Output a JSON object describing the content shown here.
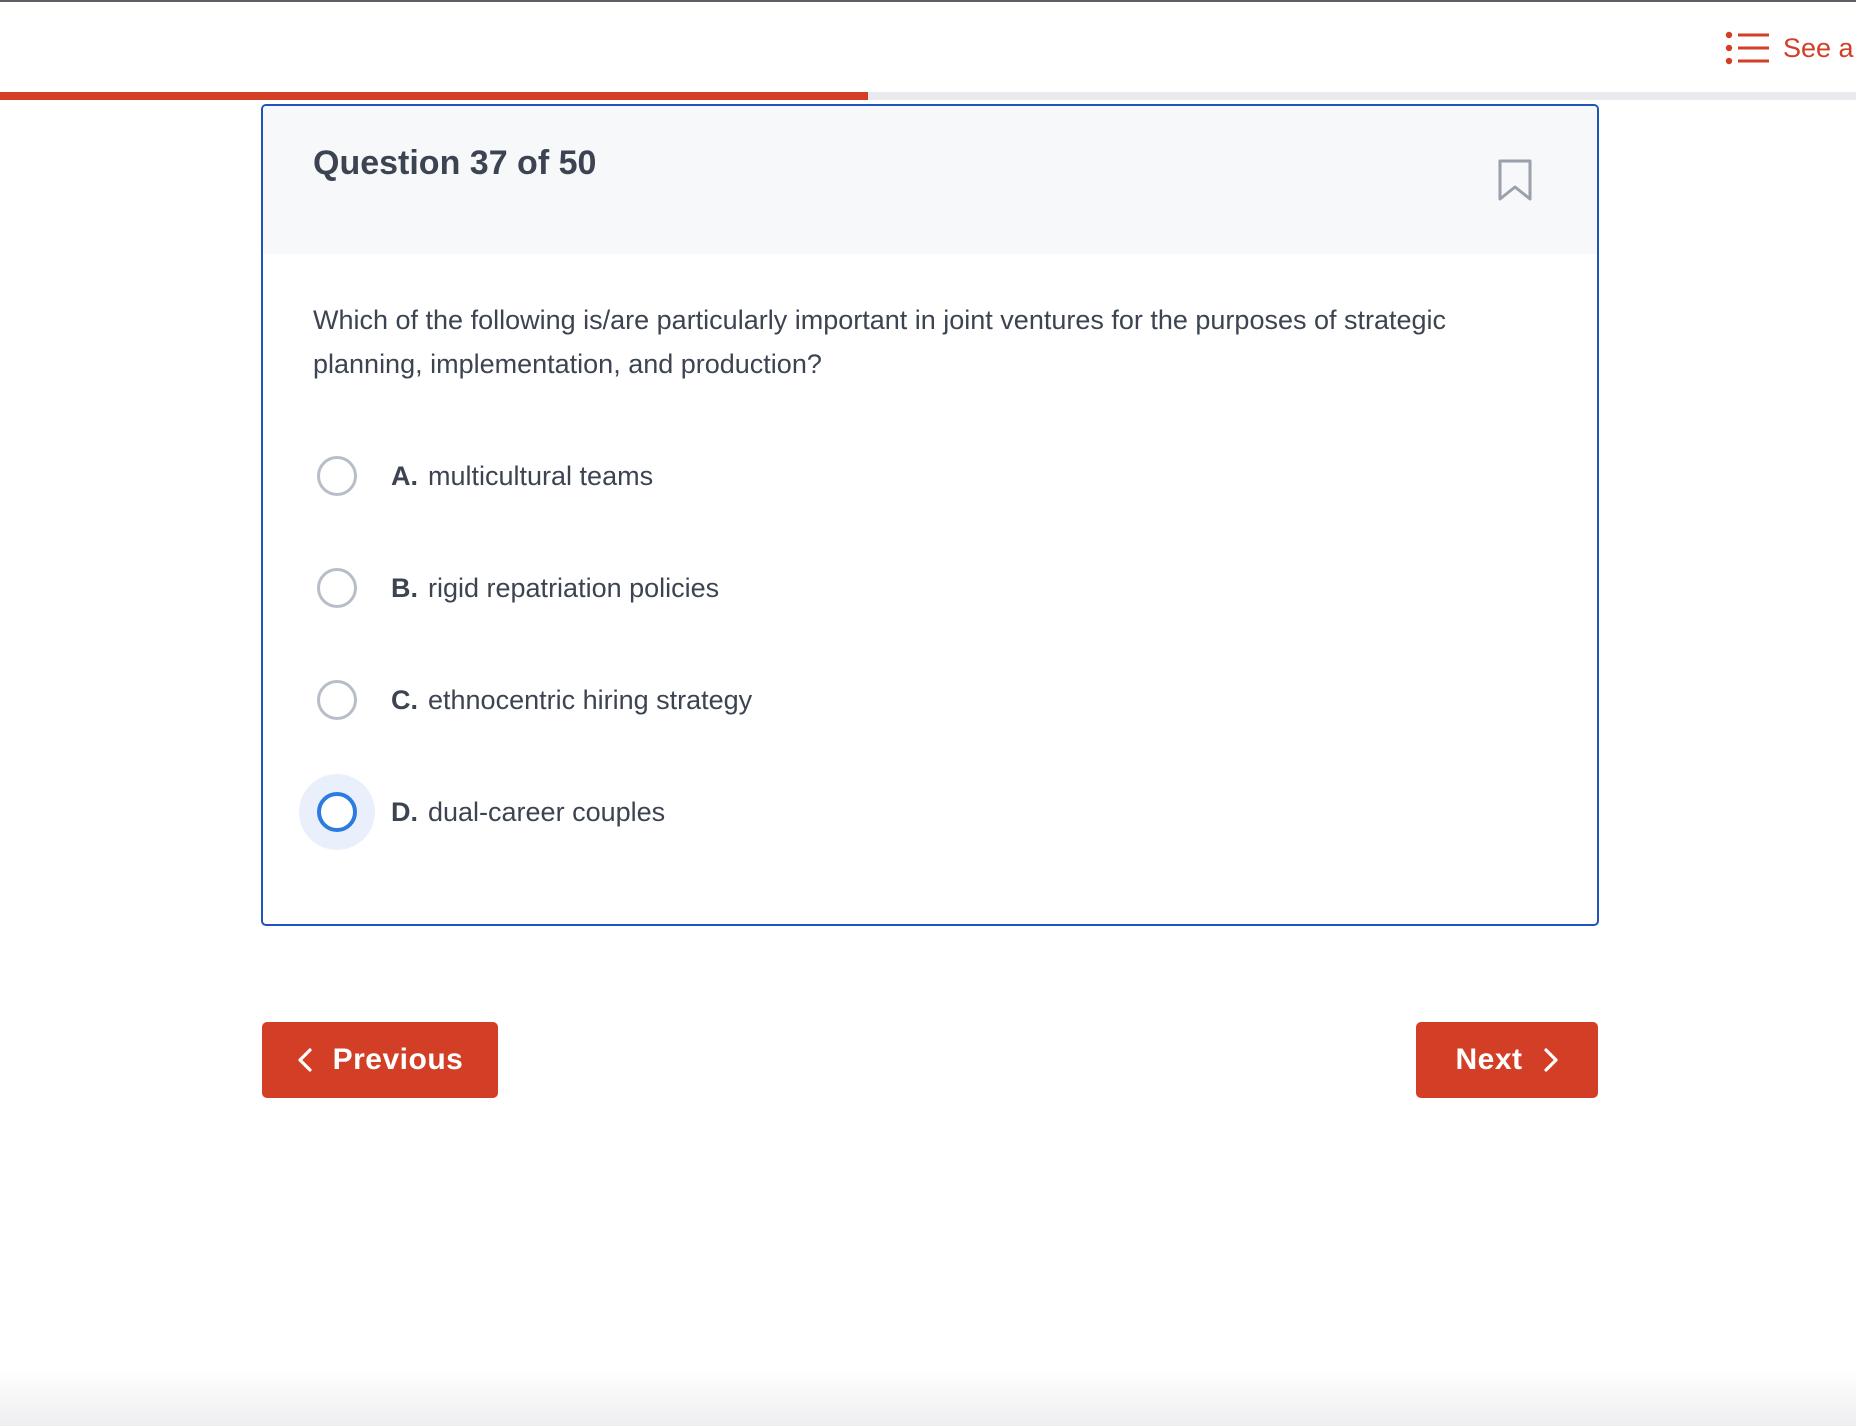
{
  "header": {
    "see_all_label": "See a",
    "progress_fraction": 0.4675
  },
  "question": {
    "title": "Question 37 of 50",
    "text": "Which of the following is/are particularly important in joint ventures for the purposes of strategic planning, implementation, and production?",
    "options": [
      {
        "letter": "A.",
        "text": "multicultural teams"
      },
      {
        "letter": "B.",
        "text": "rigid repatriation policies"
      },
      {
        "letter": "C.",
        "text": "ethnocentric hiring strategy"
      },
      {
        "letter": "D.",
        "text": "dual-career couples"
      }
    ],
    "focused_option": "D"
  },
  "nav": {
    "previous_label": "Previous",
    "next_label": "Next"
  },
  "colors": {
    "accent": "#d23f26",
    "card_border": "#1f55b9",
    "radio_focus": "#2d7be0"
  },
  "icons": {
    "see_all": "list-icon",
    "bookmark": "bookmark-icon",
    "previous": "chevron-left-icon",
    "next": "chevron-right-icon"
  }
}
